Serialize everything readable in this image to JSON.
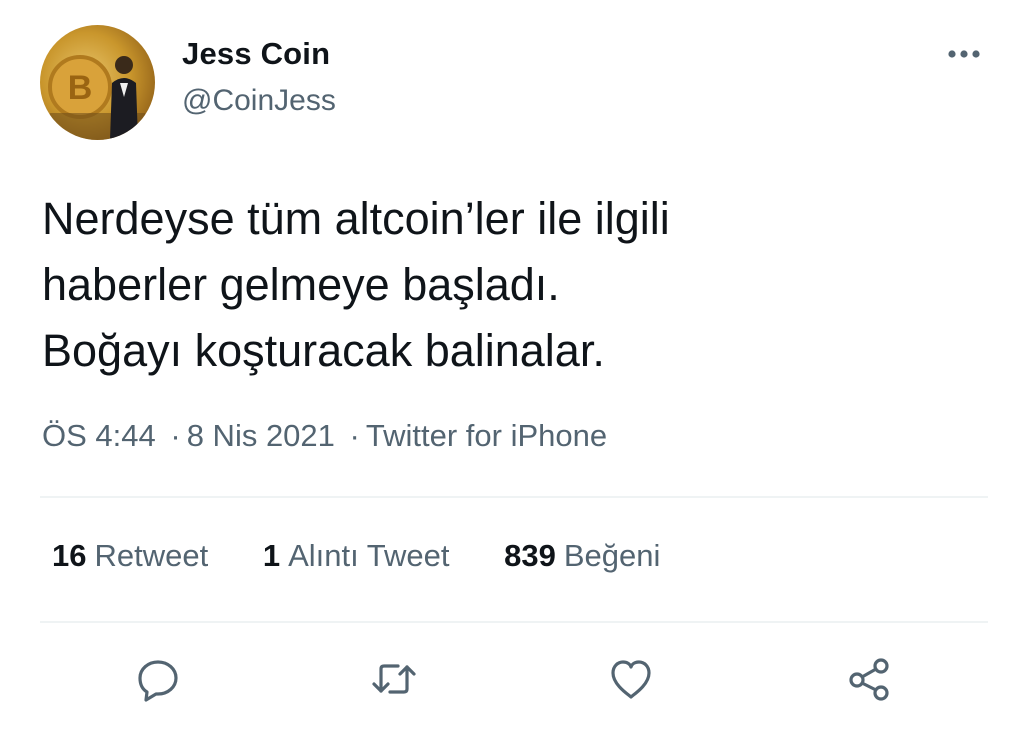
{
  "author": {
    "display_name": "Jess Coin",
    "handle": "@CoinJess",
    "avatar_icon": "avatar-photo",
    "avatar_lettering": "B"
  },
  "menu": {
    "more_icon": "more-horizontal-icon"
  },
  "tweet": {
    "lines": [
      "Nerdeyse tüm altcoin’ler ile ilgili",
      "haberler gelmeye başladı.",
      "Boğayı koşturacak balinalar."
    ]
  },
  "meta": {
    "time": "ÖS 4:44",
    "separator": "·",
    "date": "8 Nis 2021",
    "source": "Twitter for iPhone"
  },
  "stats": {
    "retweets": {
      "count": "16",
      "label": "Retweet"
    },
    "quotes": {
      "count": "1",
      "label": "Alıntı Tweet"
    },
    "likes": {
      "count": "839",
      "label": "Beğeni"
    }
  },
  "actions": {
    "reply_icon": "reply-icon",
    "retweet_icon": "retweet-icon",
    "like_icon": "heart-icon",
    "share_icon": "share-icon"
  },
  "colors": {
    "text_primary": "#0f1419",
    "text_secondary": "#536471",
    "divider": "#eff3f4"
  }
}
